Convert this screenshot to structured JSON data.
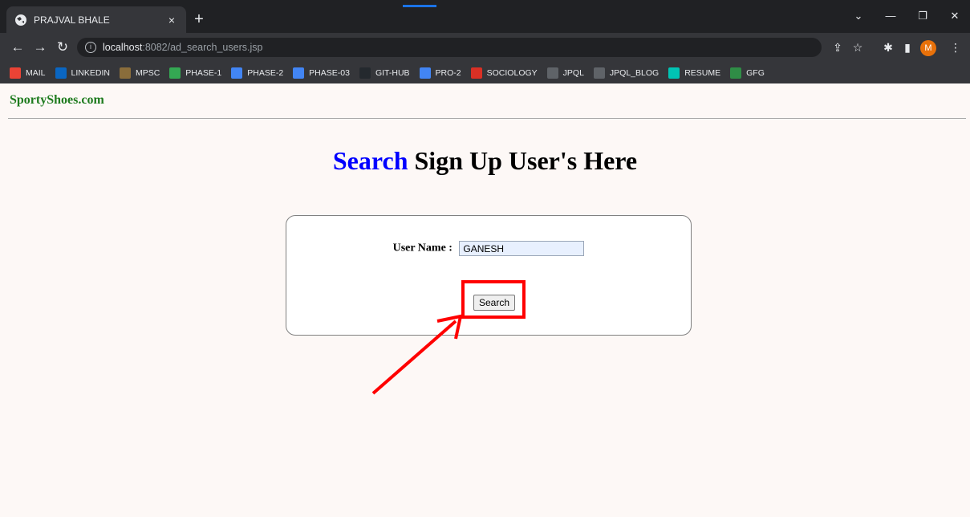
{
  "browser": {
    "tab_title": "PRAJVAL BHALE",
    "tab_close": "×",
    "new_tab": "+",
    "url_host": "localhost",
    "url_rest": ":8082/ad_search_users.jsp",
    "profile_initial": "M",
    "bookmarks": [
      {
        "label": "MAIL",
        "icon": "gmail-icon",
        "color": "#ea4335"
      },
      {
        "label": "LINKEDIN",
        "icon": "linkedin-icon",
        "color": "#0a66c2"
      },
      {
        "label": "MPSC",
        "icon": "emblem-icon",
        "color": "#8a6d3b"
      },
      {
        "label": "PHASE-1",
        "icon": "drive-icon",
        "color": "#34a853"
      },
      {
        "label": "PHASE-2",
        "icon": "docs-icon",
        "color": "#4285f4"
      },
      {
        "label": "PHASE-03",
        "icon": "docs-icon",
        "color": "#4285f4"
      },
      {
        "label": "GIT-HUB",
        "icon": "github-icon",
        "color": "#24292e"
      },
      {
        "label": "PRO-2",
        "icon": "docs-icon",
        "color": "#4285f4"
      },
      {
        "label": "SOCIOLOGY",
        "icon": "red-square-icon",
        "color": "#d93025"
      },
      {
        "label": "JPQL",
        "icon": "jpql-icon",
        "color": "#5f6368"
      },
      {
        "label": "JPQL_BLOG",
        "icon": "globe-icon",
        "color": "#5f6368"
      },
      {
        "label": "RESUME",
        "icon": "n-logo-icon",
        "color": "#00c4b4"
      },
      {
        "label": "GFG",
        "icon": "gfg-icon",
        "color": "#2f8d46"
      }
    ]
  },
  "page": {
    "brand": "SportyShoes.com",
    "heading_highlight": "Search",
    "heading_rest": " Sign Up User's Here",
    "form": {
      "label": "User Name :",
      "value": "GANESH",
      "button": "Search"
    }
  },
  "colors": {
    "brand": "#1e7b1e",
    "heading_highlight": "#0000ff",
    "annotation": "#ff0000"
  }
}
